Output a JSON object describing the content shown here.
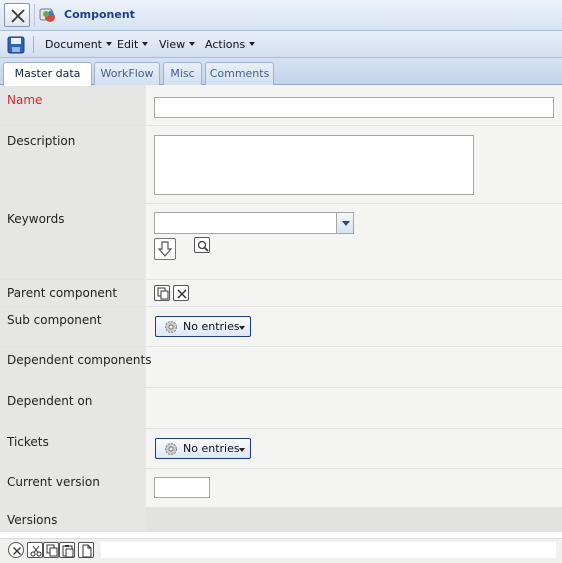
{
  "window": {
    "title": "Component",
    "icons": {
      "close": "close-x-icon",
      "app": "component-icon"
    }
  },
  "menubar": {
    "save_icon": "save-disk-icon",
    "items": [
      {
        "label": "Document"
      },
      {
        "label": "Edit"
      },
      {
        "label": "View"
      },
      {
        "label": "Actions"
      }
    ]
  },
  "tabs": [
    {
      "label": "Master data",
      "active": true
    },
    {
      "label": "WorkFlow",
      "active": false
    },
    {
      "label": "Misc",
      "active": false
    },
    {
      "label": "Comments",
      "active": false
    }
  ],
  "form": {
    "name": {
      "label": "Name",
      "value": "",
      "required_color": "#d22b2b"
    },
    "description": {
      "label": "Description",
      "value": ""
    },
    "keywords": {
      "label": "Keywords",
      "value": "",
      "icons": [
        "arrow-down-icon",
        "magnifier-icon"
      ]
    },
    "parent_component": {
      "label": "Parent component",
      "icons": [
        "copy-icon",
        "remove-x-icon"
      ]
    },
    "sub_component": {
      "label": "Sub component",
      "button": "No entries"
    },
    "dependent_components": {
      "label": "Dependent components"
    },
    "dependent_on": {
      "label": "Dependent on"
    },
    "tickets": {
      "label": "Tickets",
      "button": "No entries"
    },
    "current_version": {
      "label": "Current version",
      "value": ""
    },
    "versions": {
      "label": "Versions"
    }
  },
  "bottom_toolbar": {
    "icons": [
      "remove-x-icon",
      "cut-icon",
      "copy-icon",
      "paste-icon",
      "new-document-icon"
    ]
  },
  "colors": {
    "accent": "#1d3f8a",
    "required": "#d22b2b",
    "label_bg": "#e6e6e4",
    "field_bg": "#f4f4f2"
  }
}
